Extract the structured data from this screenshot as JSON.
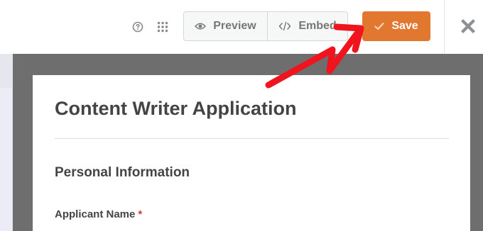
{
  "toolbar": {
    "help_icon": "question-circle-icon",
    "grid_icon": "grid-dots-icon",
    "preview_label": "Preview",
    "preview_icon": "eye-icon",
    "embed_label": "Embed",
    "embed_icon": "code-icon",
    "save_label": "Save",
    "save_icon": "check-icon",
    "close_icon": "close-icon",
    "accent_color": "#e27730"
  },
  "form": {
    "title": "Content Writer Application",
    "section": "Personal Information",
    "fields": [
      {
        "label": "Applicant Name",
        "required_mark": "*"
      }
    ]
  },
  "annotation": {
    "arrow_color": "#f0141e",
    "target": "save-button"
  }
}
